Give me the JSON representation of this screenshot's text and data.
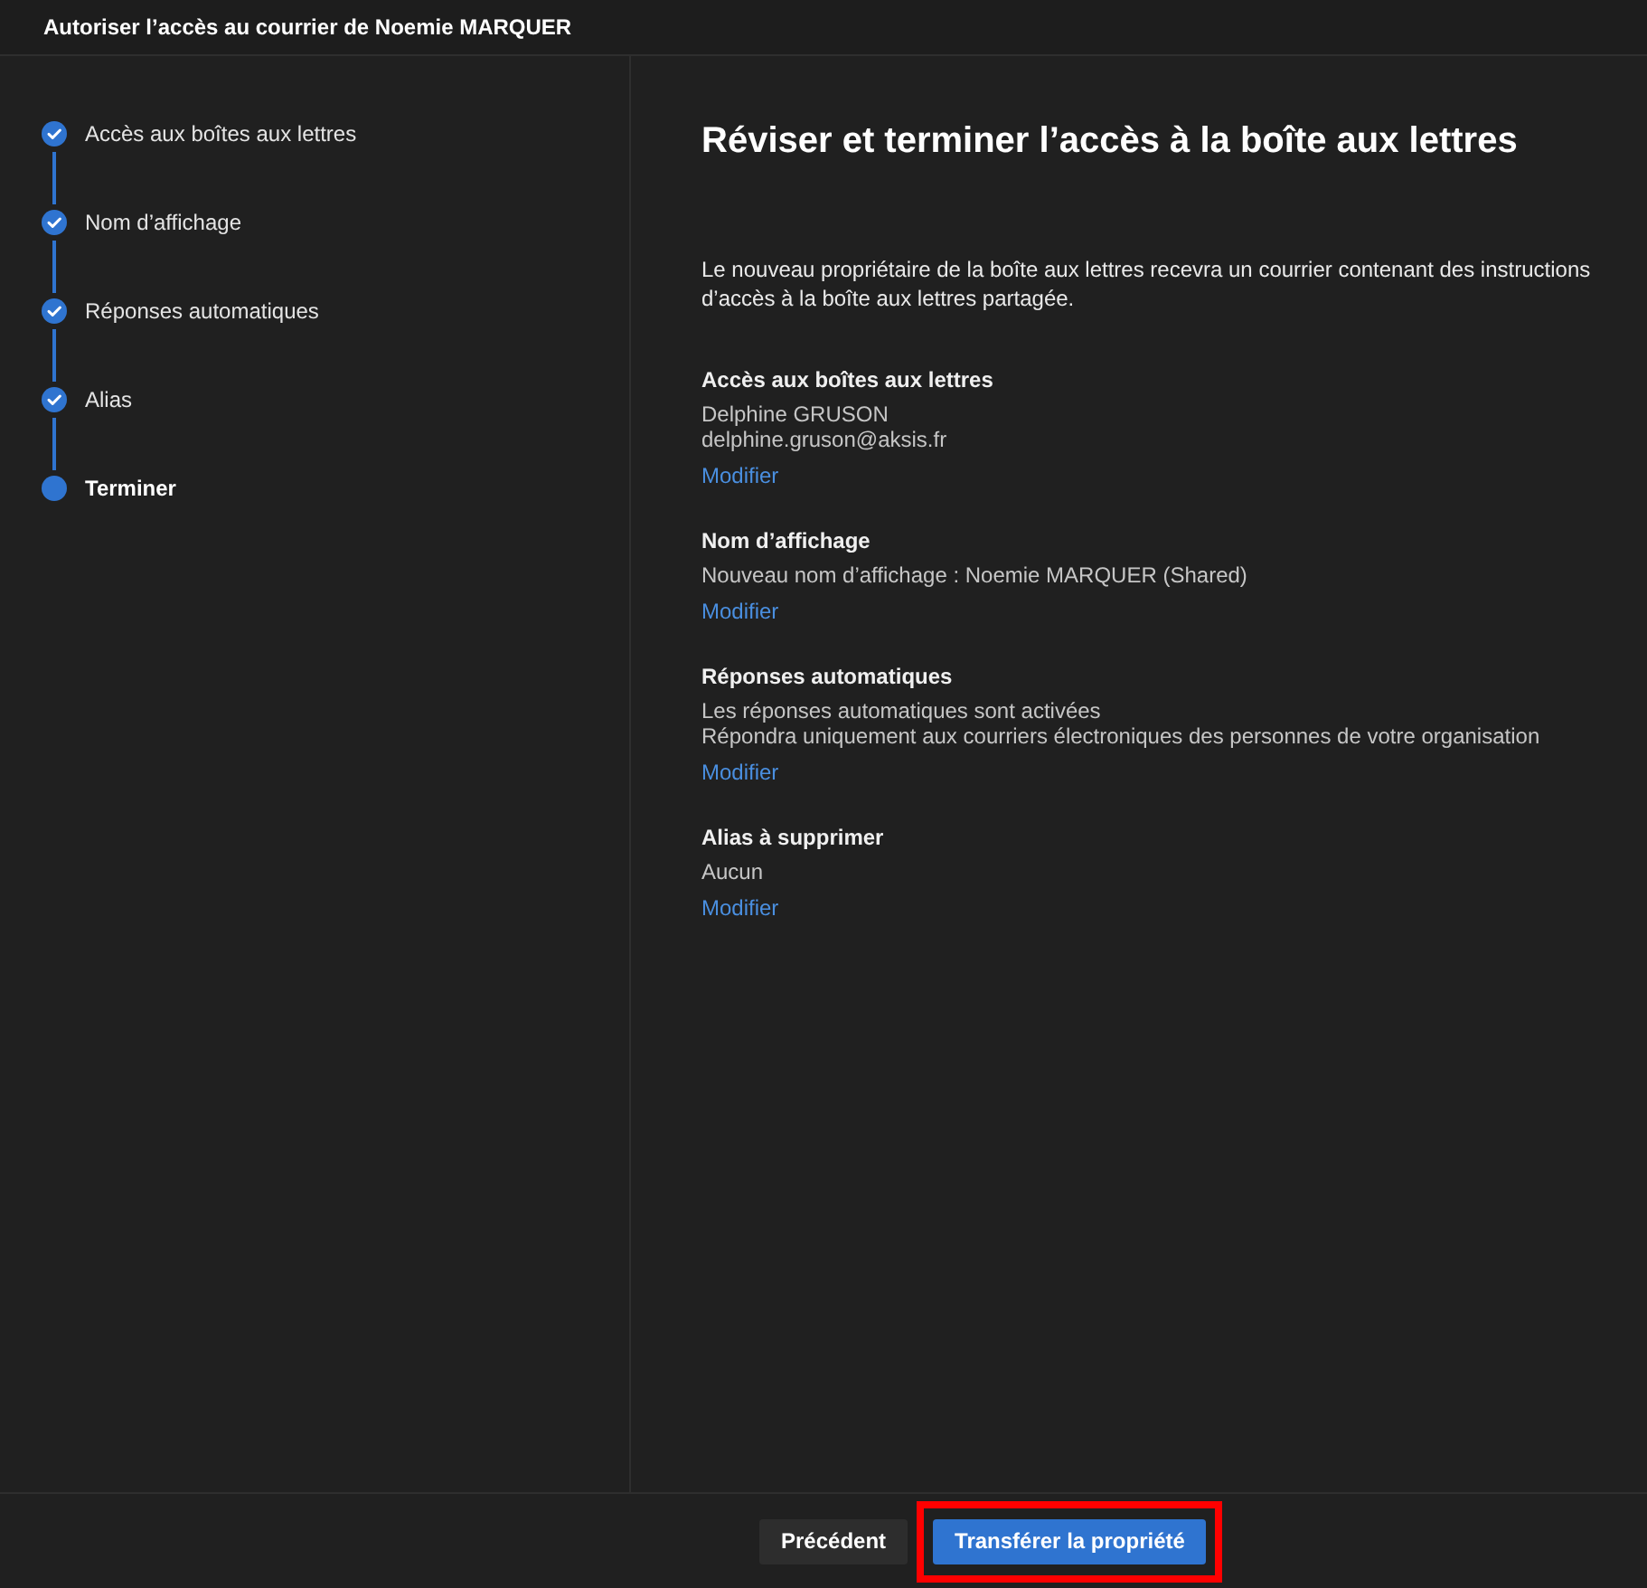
{
  "window": {
    "title": "Autoriser l’accès au courrier de Noemie MARQUER"
  },
  "steps": [
    {
      "label": "Accès aux boîtes aux lettres",
      "completed": true,
      "selected": false
    },
    {
      "label": "Nom d’affichage",
      "completed": true,
      "selected": false
    },
    {
      "label": "Réponses automatiques",
      "completed": true,
      "selected": false
    },
    {
      "label": "Alias",
      "completed": true,
      "selected": false
    },
    {
      "label": "Terminer",
      "completed": false,
      "selected": true
    }
  ],
  "page": {
    "title": "Réviser et terminer l’accès à la boîte aux lettres",
    "description": "Le nouveau propriétaire de la boîte aux lettres recevra un courrier contenant des instructions d’accès à la boîte aux lettres partagée."
  },
  "sections": [
    {
      "heading": "Accès aux boîtes aux lettres",
      "lines": [
        "Delphine GRUSON",
        "delphine.gruson@aksis.fr"
      ],
      "link": "Modifier"
    },
    {
      "heading": "Nom d’affichage",
      "lines": [
        "Nouveau nom d’affichage : Noemie MARQUER (Shared)"
      ],
      "link": "Modifier"
    },
    {
      "heading": "Réponses automatiques",
      "lines": [
        "Les réponses automatiques sont activées",
        "Répondra uniquement aux courriers électroniques des personnes de votre organisation"
      ],
      "link": "Modifier"
    },
    {
      "heading": "Alias à supprimer",
      "lines": [
        "Aucun"
      ],
      "link": "Modifier"
    }
  ],
  "buttons": [
    {
      "label": "Précédent",
      "kind": "secondary",
      "highlighted": false
    },
    {
      "label": "Transférer la propriété",
      "kind": "primary",
      "highlighted": true
    }
  ]
}
